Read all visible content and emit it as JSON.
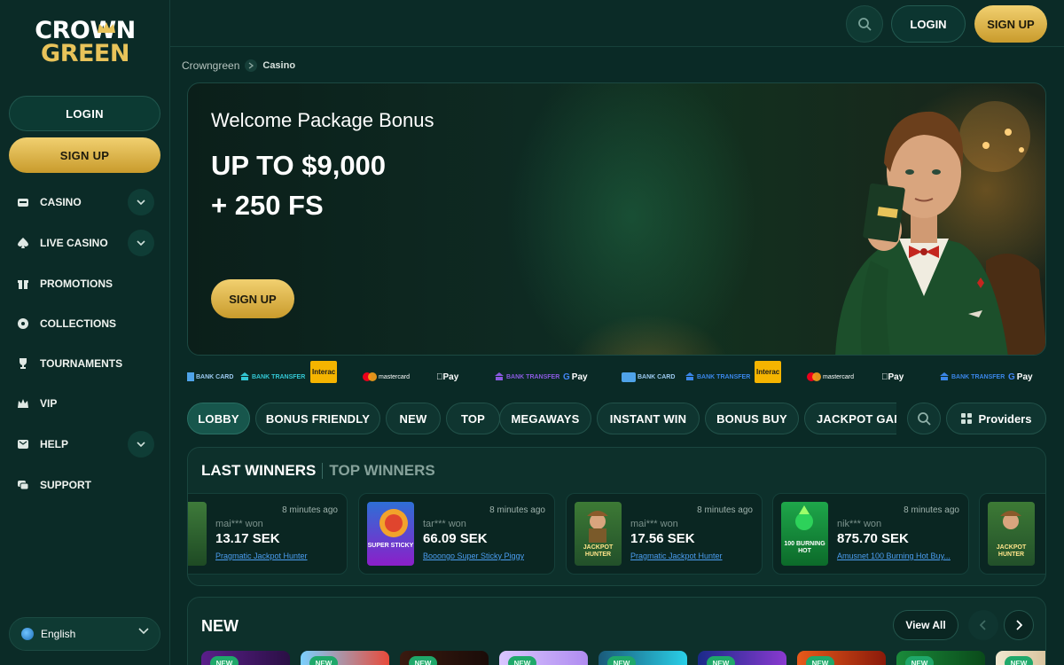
{
  "brand": {
    "line1": "CROWN",
    "line2": "GREEN"
  },
  "sidebar": {
    "login_label": "LOGIN",
    "signup_label": "SIGN UP",
    "items": [
      {
        "label": "CASINO",
        "icon": "casino-icon",
        "expandable": true
      },
      {
        "label": "LIVE CASINO",
        "icon": "spade-icon",
        "expandable": true
      },
      {
        "label": "PROMOTIONS",
        "icon": "gift-icon",
        "expandable": false
      },
      {
        "label": "COLLECTIONS",
        "icon": "collections-icon",
        "expandable": false
      },
      {
        "label": "TOURNAMENTS",
        "icon": "trophy-icon",
        "expandable": false
      },
      {
        "label": "VIP",
        "icon": "crown-icon",
        "expandable": false
      },
      {
        "label": "HELP",
        "icon": "help-icon",
        "expandable": true
      },
      {
        "label": "SUPPORT",
        "icon": "chat-icon",
        "expandable": false
      }
    ],
    "language": "English"
  },
  "header": {
    "login_label": "LOGIN",
    "signup_label": "SIGN UP"
  },
  "breadcrumb": {
    "root": "Crowngreen",
    "current": "Casino"
  },
  "hero": {
    "title": "Welcome Package Bonus",
    "amount_line1": "UP TO $9,000",
    "amount_line2": "+ 250 FS",
    "cta": "SIGN UP",
    "card_text": "Interac"
  },
  "payments": [
    "BANK CARD",
    "BANK TRANSFER",
    "Interac",
    "mastercard",
    "Pay",
    "BANK TRANSFER",
    "Pay",
    "BANK CARD",
    "BANK TRANSFER",
    "Interac",
    "mastercard",
    "Pay",
    "BANK TRANSFER",
    "Pay"
  ],
  "tabs": [
    "LOBBY",
    "BONUS FRIENDLY",
    "NEW",
    "TOP",
    "MEGAWAYS",
    "INSTANT WIN",
    "BONUS BUY",
    "JACKPOT GAMES"
  ],
  "providers_label": "Providers",
  "winners": {
    "tab_last": "LAST WINNERS",
    "tab_top": "TOP WINNERS",
    "cards": [
      {
        "user": "mai*** won",
        "time": "8 minutes ago",
        "amount": "13.17 SEK",
        "game": "Pragmatic Jackpot Hunter"
      },
      {
        "user": "tar*** won",
        "time": "8 minutes ago",
        "amount": "66.09 SEK",
        "game": "Booongo Super Sticky Piggy",
        "thumb_text": "SUPER STICKY"
      },
      {
        "user": "mai*** won",
        "time": "8 minutes ago",
        "amount": "17.56 SEK",
        "game": "Pragmatic Jackpot Hunter",
        "thumb_text": "JACKPOT HUNTER"
      },
      {
        "user": "nik*** won",
        "time": "8 minutes ago",
        "amount": "875.70 SEK",
        "game": "Amusnet 100 Burning Hot Buy...",
        "thumb_text": "100 BURNING HOT"
      },
      {
        "thumb_text": "JACKPOT HUNTER"
      }
    ]
  },
  "new_section": {
    "title": "NEW",
    "view_all": "View All",
    "badge": "NEW"
  },
  "colors": {
    "gold": "#e8c35a",
    "bg": "#0a2a26",
    "panel": "#0d302b",
    "link": "#4b9df0"
  }
}
